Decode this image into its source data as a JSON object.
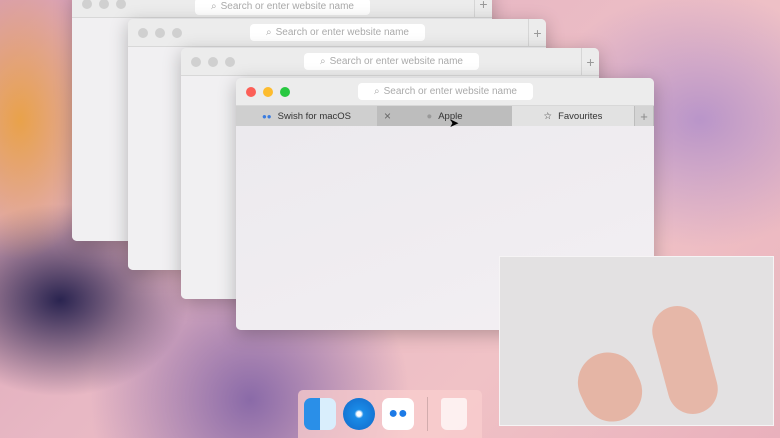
{
  "search_placeholder": "Search or enter website name",
  "tabs": [
    {
      "label": "Swish for macOS"
    },
    {
      "label": "Apple"
    },
    {
      "label": "Favourites"
    }
  ],
  "new_tab": "+",
  "close_tab": "×",
  "dock": [
    "Finder",
    "Safari",
    "Swish",
    "Trash"
  ]
}
